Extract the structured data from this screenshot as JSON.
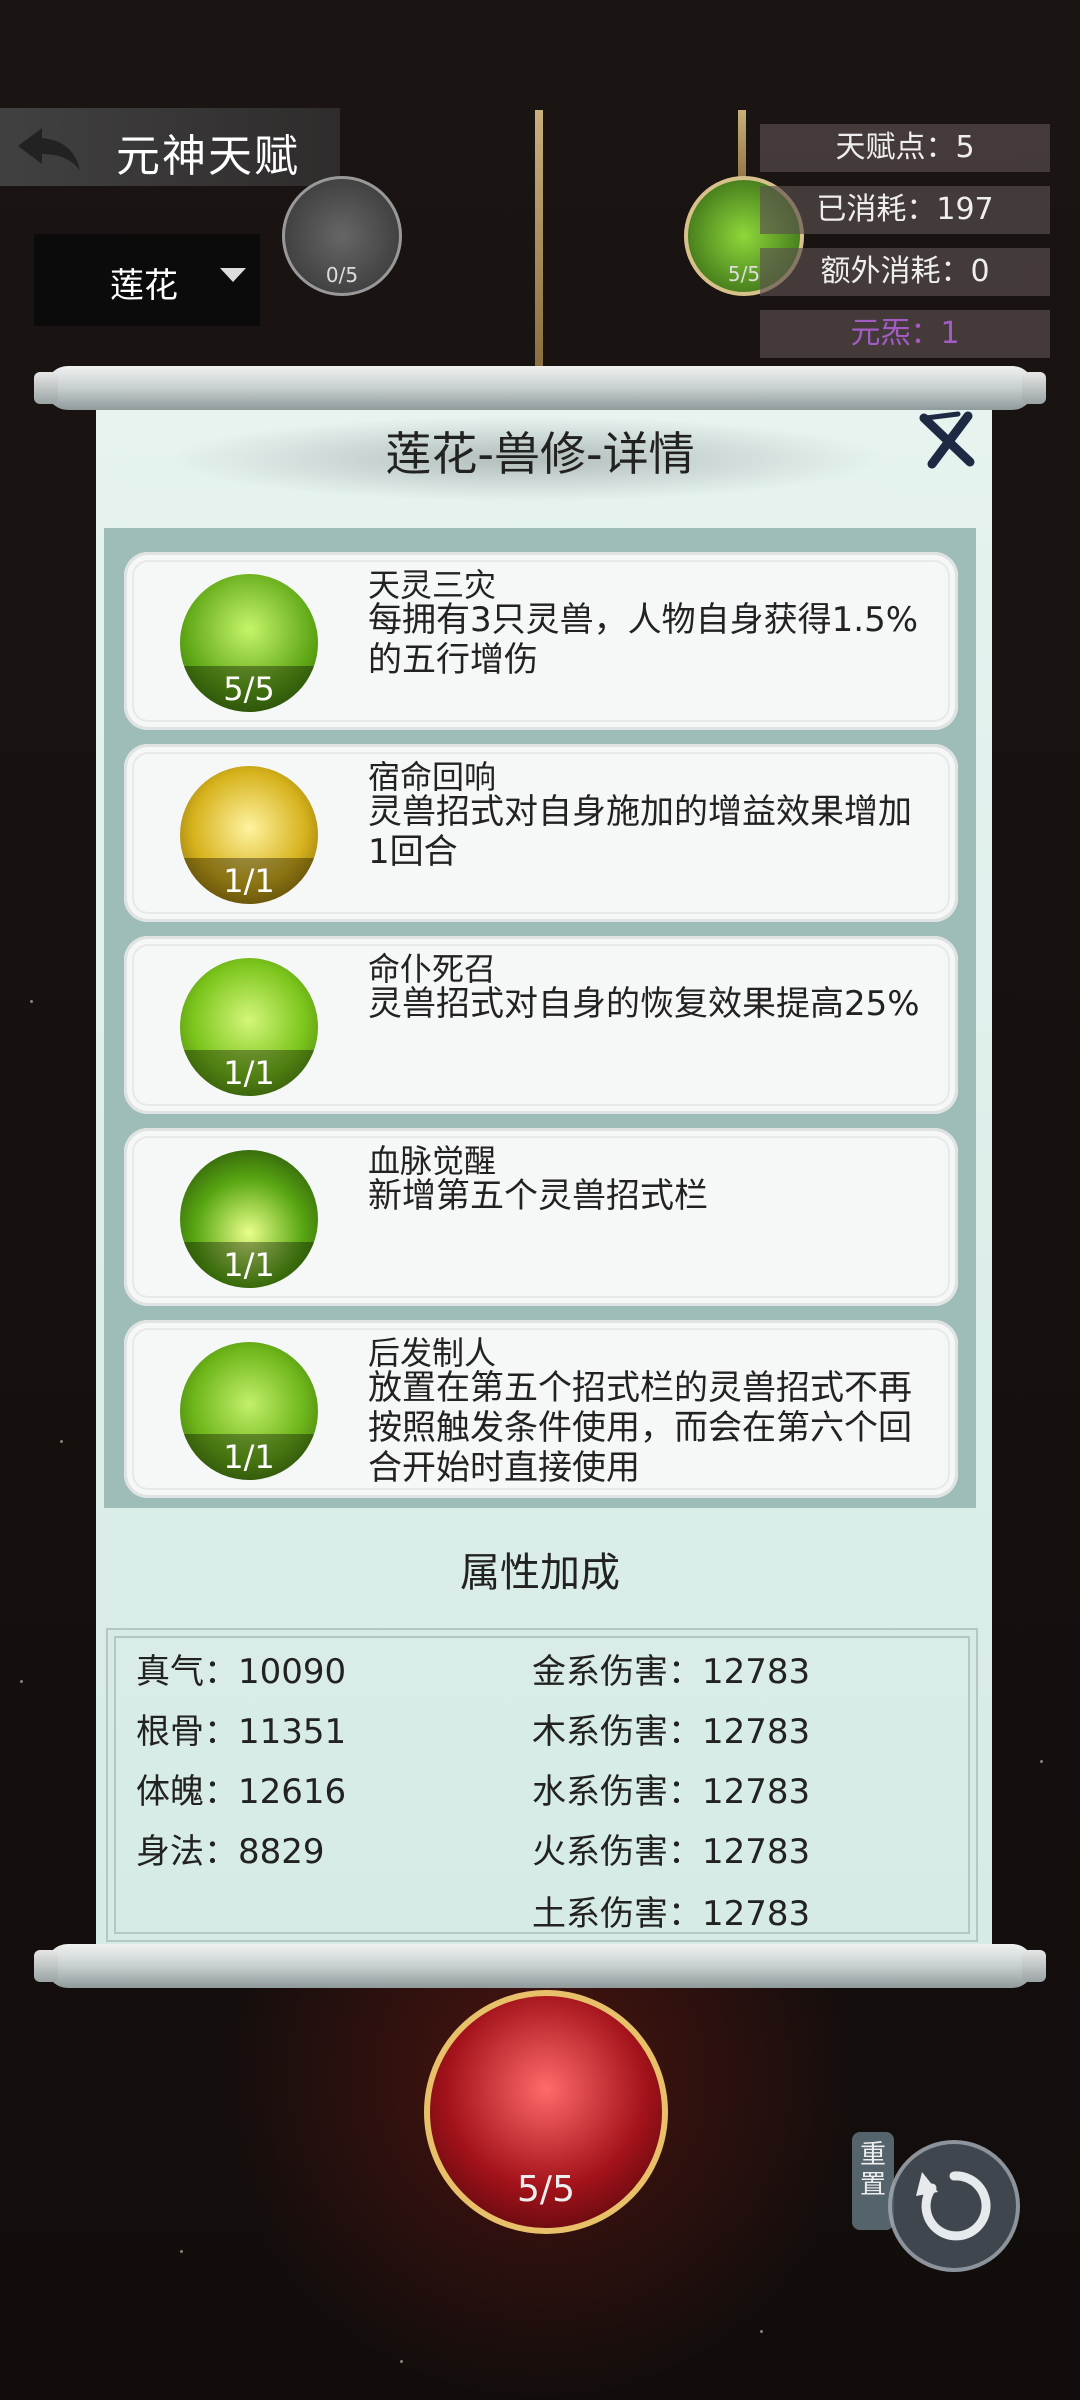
{
  "header": {
    "title": "元神天赋"
  },
  "dropdown": {
    "selected": "莲花"
  },
  "top_nodes": [
    {
      "count": "0/5"
    },
    {
      "count": "5/5"
    }
  ],
  "stats": {
    "talent_points": "天赋点：5",
    "consumed": "已消耗：197",
    "extra_consumed": "额外消耗：0",
    "element": "元炁：1"
  },
  "dialog": {
    "title": "莲花-兽修-详情",
    "skills": [
      {
        "name": "天灵三灾",
        "desc": "每拥有3只灵兽，人物自身获得1.5%的五行增伤",
        "level": "5/5",
        "icon": "green-flame-beast-icon"
      },
      {
        "name": "宿命回响",
        "desc": "灵兽招式对自身施加的增益效果增加1回合",
        "level": "1/1",
        "icon": "golden-swirl-icon"
      },
      {
        "name": "命仆死召",
        "desc": "灵兽招式对自身的恢复效果提高25%",
        "level": "1/1",
        "icon": "green-plus-heal-icon"
      },
      {
        "name": "血脉觉醒",
        "desc": "新增第五个灵兽招式栏",
        "level": "1/1",
        "icon": "green-awaken-flame-icon"
      },
      {
        "name": "后发制人",
        "desc": "放置在第五个招式栏的灵兽招式不再按照触发条件使用，而会在第六个回合开始时直接使用",
        "level": "1/1",
        "icon": "green-figures-icon"
      }
    ],
    "attributes_title": "属性加成",
    "attributes_left": [
      "真气：10090",
      "根骨：11351",
      "体魄：12616",
      "身法：8829"
    ],
    "attributes_right": [
      "金系伤害：12783",
      "木系伤害：12783",
      "水系伤害：12783",
      "火系伤害：12783",
      "土系伤害：12783"
    ]
  },
  "bottom_node": {
    "count": "5/5"
  },
  "reset": {
    "label": "重置"
  },
  "colors": {
    "element_text": "#a25cc4",
    "skill_green": "#7fd12a",
    "skill_gold": "#e5c23a"
  }
}
